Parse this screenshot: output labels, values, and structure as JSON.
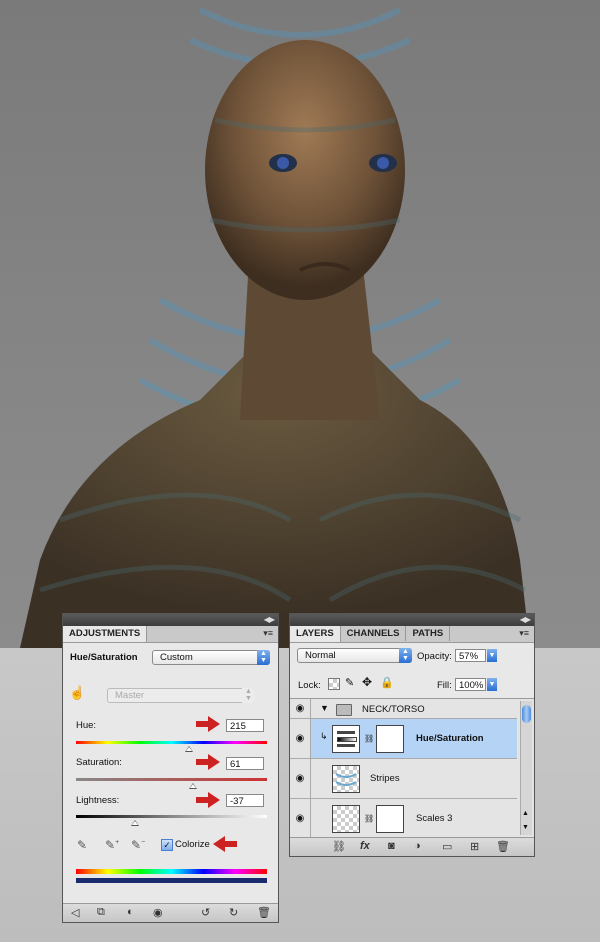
{
  "adjustments": {
    "tab_label": "ADJUSTMENTS",
    "mode_label": "Hue/Saturation",
    "preset_value": "Custom",
    "channel_value": "Master",
    "hue_label": "Hue:",
    "hue_value": "215",
    "saturation_label": "Saturation:",
    "saturation_value": "61",
    "lightness_label": "Lightness:",
    "lightness_value": "-37",
    "colorize_label": "Colorize"
  },
  "layers": {
    "tabs": [
      "LAYERS",
      "CHANNELS",
      "PATHS"
    ],
    "blend_mode": "Normal",
    "opacity_label": "Opacity:",
    "opacity_value": "57%",
    "lock_label": "Lock:",
    "fill_label": "Fill:",
    "fill_value": "100%",
    "group_name": "NECK/TORSO",
    "rows": [
      {
        "name": "Hue/Saturation"
      },
      {
        "name": "Stripes"
      },
      {
        "name": "Scales 3"
      }
    ]
  },
  "colors": {
    "accent_blue": "#2a6ed3",
    "selected_row": "#b5d3f5",
    "red_arrow": "#cc2222"
  }
}
